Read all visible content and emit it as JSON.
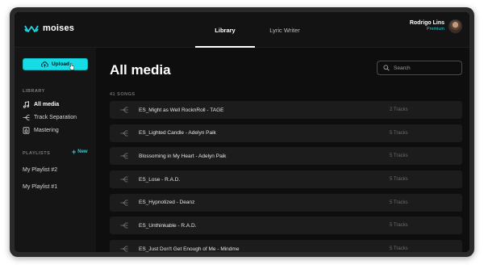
{
  "app": {
    "name": "moises"
  },
  "nav": {
    "tabs": [
      {
        "label": "Library"
      },
      {
        "label": "Lyric Writer"
      }
    ]
  },
  "user": {
    "name": "Rodrigo Lins",
    "plan": "Premium"
  },
  "sidebar": {
    "upload_label": "Upload",
    "library_label": "LIBRARY",
    "items": [
      {
        "label": "All media",
        "icon": "music-note-icon"
      },
      {
        "label": "Track Separation",
        "icon": "split-icon"
      },
      {
        "label": "Mastering",
        "icon": "mastering-icon"
      }
    ],
    "playlists_label": "PLAYLISTS",
    "new_label": "New",
    "playlists": [
      {
        "label": "My Playlist #2"
      },
      {
        "label": "My Playlist #1"
      }
    ]
  },
  "main": {
    "title": "All media",
    "search_placeholder": "Search",
    "count_label": "41 SONGS",
    "songs": [
      {
        "title": "ES_Might as Well RocknRoll - TAGE",
        "tracks": "2 Tracks"
      },
      {
        "title": "ES_Lighted Candle - Adelyn Paik",
        "tracks": "5 Tracks"
      },
      {
        "title": "Blossoming in My Heart - Adelyn Paik",
        "tracks": "5 Tracks"
      },
      {
        "title": "ES_Lose - R.A.D.",
        "tracks": "5 Tracks"
      },
      {
        "title": "ES_Hypnotized - Deanz",
        "tracks": "5 Tracks"
      },
      {
        "title": "ES_Unthinkable - R.A.D.",
        "tracks": "5 Tracks"
      },
      {
        "title": "ES_Just Don't Get Enough of Me - Mindme",
        "tracks": "5 Tracks"
      }
    ]
  },
  "colors": {
    "accent": "#17dbe5",
    "background": "#0e0e0e",
    "row": "#1c1c1c"
  }
}
